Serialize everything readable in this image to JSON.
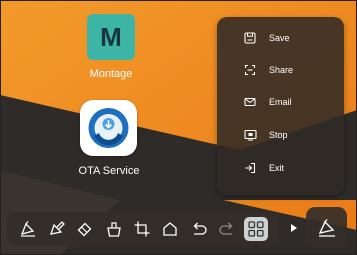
{
  "home_screen": {
    "apps": [
      {
        "name": "Montage",
        "letter": "M",
        "icon": "montage-icon"
      },
      {
        "name": "OTA Service",
        "icon": "ota-service-icon"
      }
    ]
  },
  "floating_menu": {
    "items": [
      {
        "label": "Save",
        "icon": "save-icon"
      },
      {
        "label": "Share",
        "icon": "share-icon"
      },
      {
        "label": "Email",
        "icon": "email-icon"
      },
      {
        "label": "Stop",
        "icon": "stop-icon"
      },
      {
        "label": "Exit",
        "icon": "exit-icon"
      }
    ]
  },
  "annotation_toolbar": {
    "tools": [
      "pen-icon",
      "highlighter-icon",
      "eraser-icon",
      "clear-icon",
      "crop-icon",
      "shape-icon",
      "undo-icon",
      "redo-icon",
      "menu-grid-icon"
    ],
    "active_tool": "menu-grid-icon",
    "collapse_icon": "triangle-right-icon",
    "pen_button_icon": "pen-icon"
  },
  "colors": {
    "wallpaper_orange": "#f08a22",
    "wallpaper_dark": "#2f2b29",
    "panel_dark": "#302a26",
    "montage_teal": "#3db5a6",
    "ota_blue": "#1f6fbf"
  }
}
